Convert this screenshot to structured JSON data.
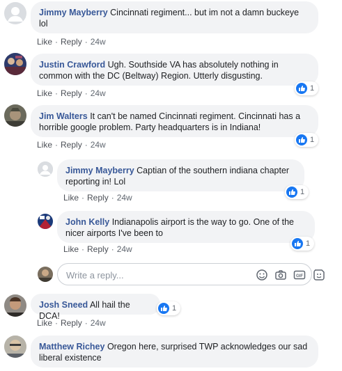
{
  "comments": [
    {
      "author": "Jimmy Mayberry",
      "text": "Cincinnati regiment... but im not a damn buckeye lol",
      "like": "Like",
      "reply": "Reply",
      "time": "24w",
      "reaction_count": ""
    },
    {
      "author": "Justin Crawford",
      "text": "Ugh. Southside VA has absolutely nothing in common with the DC (Beltway) Region. Utterly disgusting.",
      "like": "Like",
      "reply": "Reply",
      "time": "24w",
      "reaction_count": "1"
    },
    {
      "author": "Jim Walters",
      "text": "It can't be named Cincinnati regiment. Cincinnati has a horrible google problem. Party headquarters is in Indiana!",
      "like": "Like",
      "reply": "Reply",
      "time": "24w",
      "reaction_count": "1"
    },
    {
      "author": "Jimmy Mayberry",
      "text": "Captian of the southern indiana chapter reporting in! Lol",
      "like": "Like",
      "reply": "Reply",
      "time": "24w",
      "reaction_count": "1"
    },
    {
      "author": "John Kelly",
      "text": "Indianapolis airport is the way to go. One of the nicer airports I've been to",
      "like": "Like",
      "reply": "Reply",
      "time": "24w",
      "reaction_count": "1"
    },
    {
      "author": "Josh Sneed",
      "text": "All hail the DCA!",
      "like": "Like",
      "reply": "Reply",
      "time": "24w",
      "reaction_count": "1"
    },
    {
      "author": "Matthew Richey",
      "text": "Oregon here, surprised TWP acknowledges our sad liberal existence",
      "like": "",
      "reply": "",
      "time": "",
      "reaction_count": ""
    }
  ],
  "reply_box": {
    "placeholder": "Write a reply...",
    "tools": [
      "emoji-icon",
      "camera-icon",
      "gif-icon",
      "sticker-icon"
    ]
  },
  "colors": {
    "author": "#385898",
    "bubble": "#f2f3f5",
    "like_blue": "#1877f2",
    "meta": "#606770"
  }
}
